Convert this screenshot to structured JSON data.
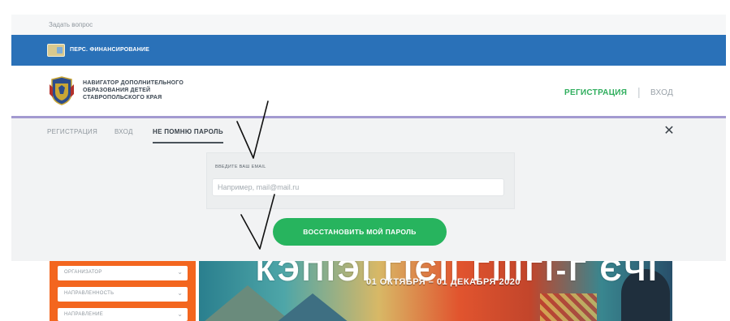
{
  "top_crumb": "",
  "ask_question": "Задать вопрос",
  "banner_strip": {
    "label": "ПЕРС. ФИНАНСИРОВАНИЕ"
  },
  "header": {
    "org_line1": "НАВИГАТОР ДОПОЛНИТЕЛЬНОГО",
    "org_line2": "ОБРАЗОВАНИЯ ДЕТЕЙ",
    "org_line3": "СТАВРОПОЛЬСКОГО КРАЯ",
    "register": "РЕГИСТРАЦИЯ",
    "separator": "|",
    "login": "ВХОД"
  },
  "modal": {
    "tabs": {
      "register": "РЕГИСТРАЦИЯ",
      "login": "ВХОД",
      "forgot": "НЕ ПОМНЮ ПАРОЛЬ"
    },
    "close_symbol": "✕",
    "email_label": "ВВЕДИТЕ ВАШ EMAIL",
    "email_value": "",
    "email_placeholder": "Например, mail@mail.ru",
    "restore_button": "ВОССТАНОВИТЬ МОЙ ПАРОЛЬ"
  },
  "filters": [
    {
      "label": "ОРГАНИЗАТОР"
    },
    {
      "label": "НАПРАВЛЕННОСТЬ"
    },
    {
      "label": "НАПРАВЛЕНИЕ"
    }
  ],
  "promo": {
    "title": "КЭПІЭІ ГІЄІІ ГІЇЇГІ-Г ЄЧІ",
    "dates": "01 ОКТЯБРЯ – 01 ДЕКАБРЯ 2020"
  },
  "colors": {
    "blue_bar": "#2a71b8",
    "accent_green": "#27b45e",
    "filter_orange": "#f3661f",
    "purple_line": "#a39ad0"
  },
  "icons": {
    "close": "close-icon",
    "chevron": "chevron-down-icon",
    "emblem": "coat-of-arms-icon",
    "financing": "financing-card-icon"
  }
}
